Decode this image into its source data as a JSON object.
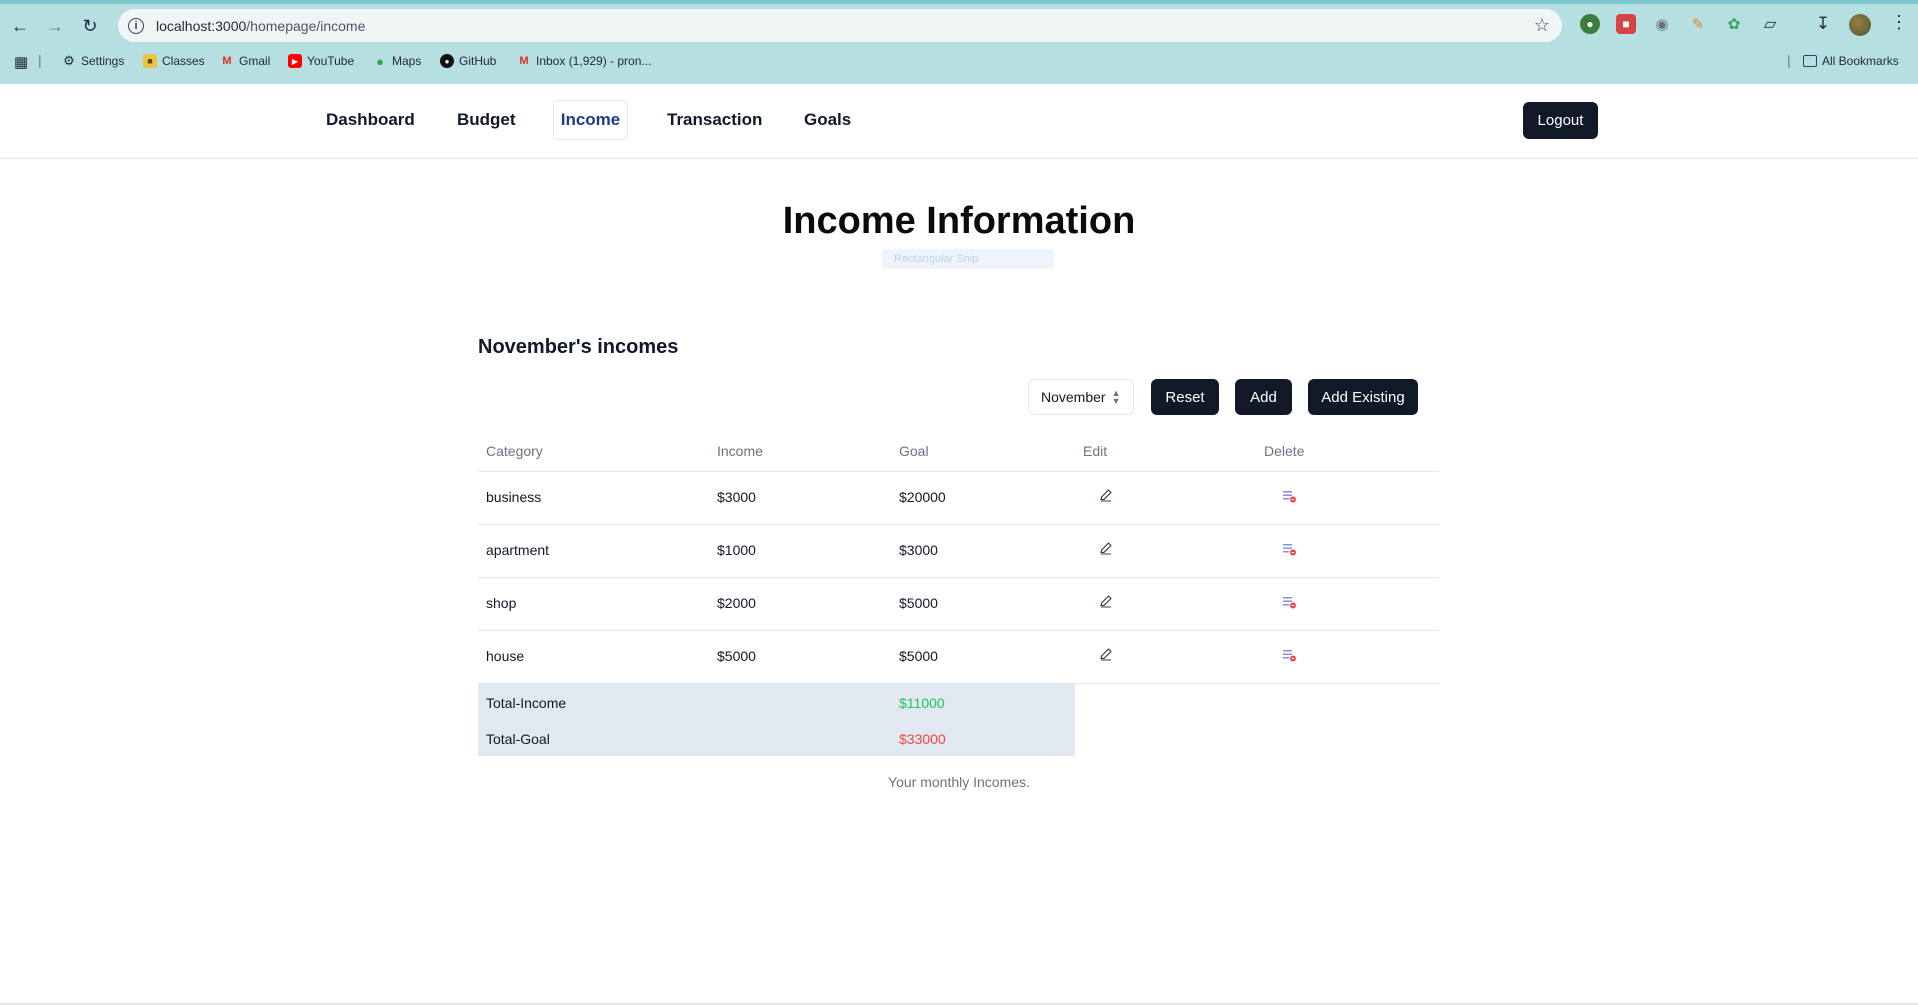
{
  "browser": {
    "url_host": "localhost:3000",
    "url_path": "/homepage/income",
    "bookmarks": [
      {
        "label": "Settings",
        "icon": "gear-icon"
      },
      {
        "label": "Classes",
        "icon": "folder-icon"
      },
      {
        "label": "Gmail",
        "icon": "gmail-icon"
      },
      {
        "label": "YouTube",
        "icon": "youtube-icon"
      },
      {
        "label": "Maps",
        "icon": "maps-icon"
      },
      {
        "label": "GitHub",
        "icon": "github-icon"
      },
      {
        "label": "Inbox (1,929) - pron...",
        "icon": "gmail-icon"
      }
    ],
    "all_bookmarks": "All Bookmarks"
  },
  "nav": {
    "items": [
      "Dashboard",
      "Budget",
      "Income",
      "Transaction",
      "Goals"
    ],
    "active": "Income",
    "logout": "Logout"
  },
  "main": {
    "title": "Income Information",
    "snip_ghost": "Rectangular Snip",
    "section_heading": "November's incomes",
    "month_select": "November",
    "buttons": {
      "reset": "Reset",
      "add": "Add",
      "add_existing": "Add Existing"
    },
    "table": {
      "headers": [
        "Category",
        "Income",
        "Goal",
        "Edit",
        "Delete"
      ],
      "rows": [
        {
          "category": "business",
          "income": "$3000",
          "goal": "$20000"
        },
        {
          "category": "apartment",
          "income": "$1000",
          "goal": "$3000"
        },
        {
          "category": "shop",
          "income": "$2000",
          "goal": "$5000"
        },
        {
          "category": "house",
          "income": "$5000",
          "goal": "$5000"
        }
      ]
    },
    "totals": {
      "income_label": "Total-Income",
      "income_value": "$11000",
      "goal_label": "Total-Goal",
      "goal_value": "$33000"
    },
    "caption": "Your monthly Incomes."
  },
  "colors": {
    "accent": "#111827",
    "active_nav": "#1e3a8a",
    "total_income": "#22c55e",
    "total_goal": "#ef4444",
    "chrome": "#b6dfe2"
  }
}
